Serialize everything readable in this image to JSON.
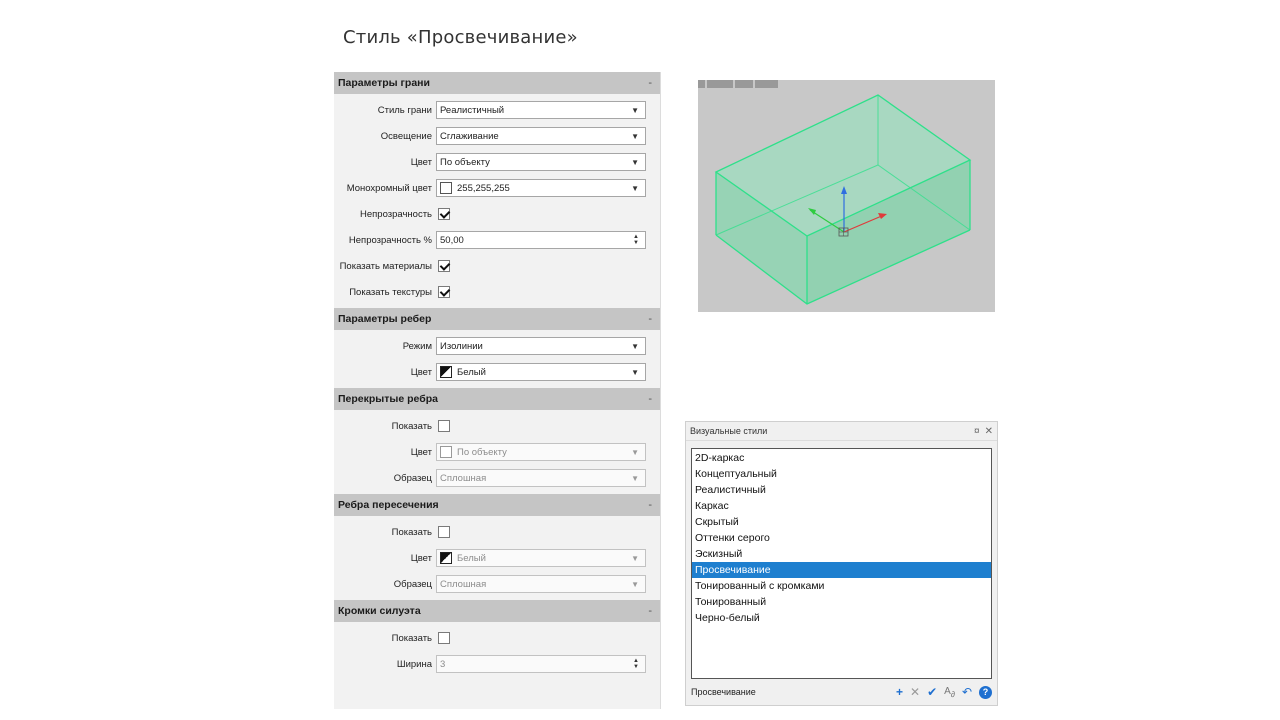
{
  "slide": {
    "title": "Стиль «Просвечивание»"
  },
  "props": {
    "face": {
      "header": "Параметры грани",
      "collapse": "-",
      "style_label": "Стиль грани",
      "style_value": "Реалистичный",
      "lighting_label": "Освещение",
      "lighting_value": "Сглаживание",
      "color_label": "Цвет",
      "color_value": "По объекту",
      "mono_label": "Монохромный цвет",
      "mono_value": "255,255,255",
      "opacity_label": "Непрозрачность",
      "opacity_checked": true,
      "opacity_pct_label": "Непрозрачность %",
      "opacity_pct_value": "50,00",
      "materials_label": "Показать материалы",
      "materials_checked": true,
      "textures_label": "Показать текстуры",
      "textures_checked": true
    },
    "edge": {
      "header": "Параметры ребер",
      "collapse": "-",
      "mode_label": "Режим",
      "mode_value": "Изолинии",
      "color_label": "Цвет",
      "color_value": "Белый"
    },
    "occluded": {
      "header": "Перекрытые ребра",
      "collapse": "-",
      "show_label": "Показать",
      "show_checked": false,
      "color_label": "Цвет",
      "color_value": "По объекту",
      "pattern_label": "Образец",
      "pattern_value": "Сплошная"
    },
    "intersection": {
      "header": "Ребра пересечения",
      "collapse": "-",
      "show_label": "Показать",
      "show_checked": false,
      "color_label": "Цвет",
      "color_value": "Белый",
      "pattern_label": "Образец",
      "pattern_value": "Сплошная"
    },
    "silhouette": {
      "header": "Кромки силуэта",
      "collapse": "-",
      "show_label": "Показать",
      "show_checked": false,
      "width_label": "Ширина",
      "width_value": "3"
    }
  },
  "viewport": {
    "bg_color": "#c8c8c8",
    "box_edge_color": "#2ee08a",
    "box_fill_color": "#7fe0b0",
    "axis_x_color": "#e03a3a",
    "axis_y_color": "#2ecc40",
    "axis_z_color": "#2f6fe0"
  },
  "visual_styles": {
    "title": "Визуальные стили",
    "pin_icon": "pin-icon",
    "close_icon": "close-icon",
    "items": [
      "2D-каркас",
      "Концептуальный",
      "Реалистичный",
      "Каркас",
      "Скрытый",
      "Оттенки серого",
      "Эскизный",
      "Просвечивание",
      "Тонированный с кромками",
      "Тонированный",
      "Черно-белый"
    ],
    "selected_index": 7,
    "current": "Просвечивание",
    "accent_color": "#1e7fcf"
  }
}
